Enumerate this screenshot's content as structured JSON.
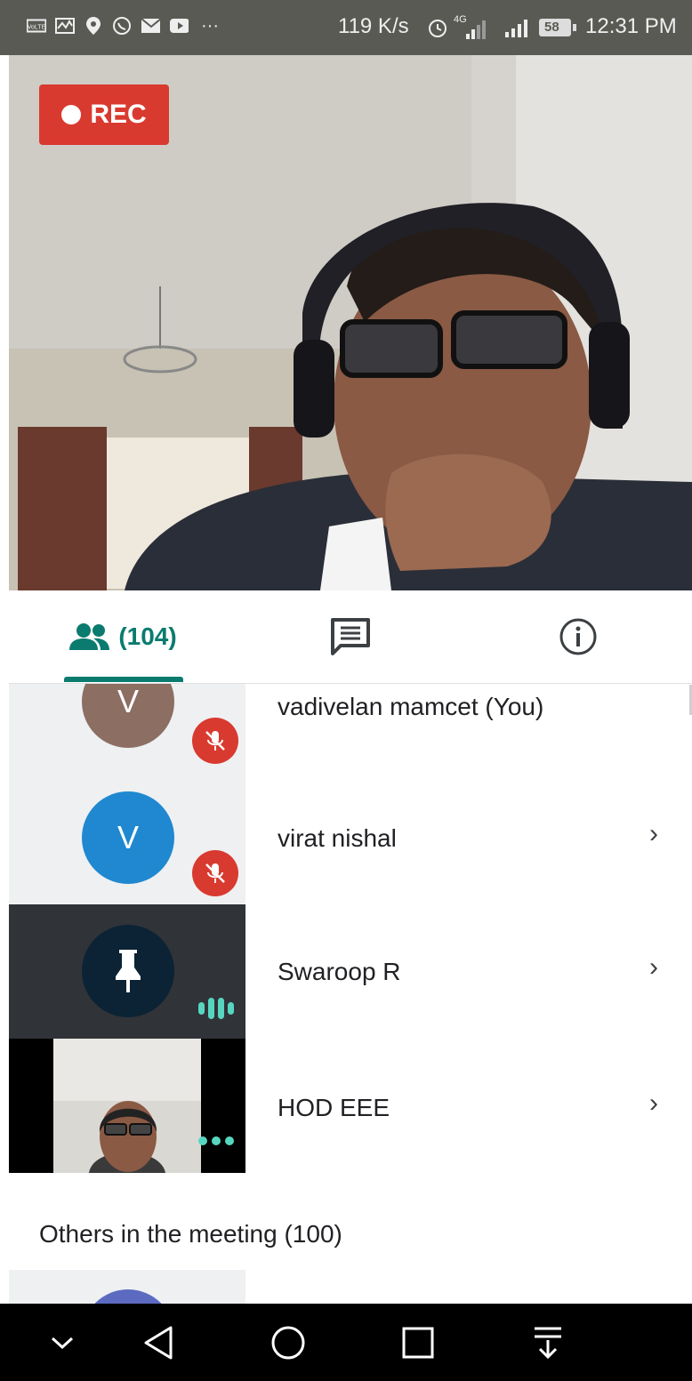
{
  "status_bar": {
    "speed": "119 K/s",
    "network": "4G",
    "battery": "58",
    "time": "12:31 PM",
    "left_icons": [
      "volte-icon",
      "activity-icon",
      "location-icon",
      "whatsapp-icon",
      "mail-icon",
      "youtube-icon"
    ],
    "more": "···"
  },
  "video": {
    "rec_label": "REC"
  },
  "tabs": {
    "people_count": "(104)",
    "active": "people"
  },
  "participants": [
    {
      "initial": "V",
      "name": "vadivelan mamcet (You)",
      "avatar_color": "#8d6e63",
      "muted": true
    },
    {
      "initial": "V",
      "name": "virat nishal",
      "avatar_color": "#1f88d0",
      "muted": true
    },
    {
      "initial": "",
      "name": "Swaroop R",
      "avatar_color": "#0b2334",
      "muted": false
    },
    {
      "initial": "",
      "name": "HOD EEE",
      "avatar_color": "",
      "muted": false
    }
  ],
  "chevron": "›",
  "others": {
    "label": "Others in the meeting (100)"
  },
  "colors": {
    "accent": "#0b7b6f",
    "rec": "#d93a2f",
    "speaking": "#56d6c0"
  }
}
